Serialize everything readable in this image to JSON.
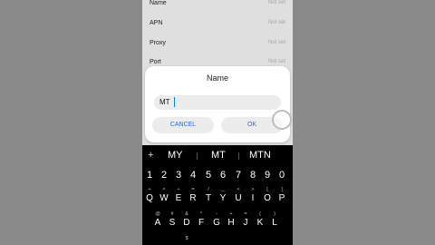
{
  "settings": {
    "rows": [
      {
        "label": "Name",
        "value": "Not set"
      },
      {
        "label": "APN",
        "value": "Not set"
      },
      {
        "label": "Proxy",
        "value": "Not set"
      },
      {
        "label": "Port",
        "value": "Not set"
      }
    ]
  },
  "dialog": {
    "title": "Name",
    "input_value": "MT",
    "cancel_label": "CANCEL",
    "ok_label": "OK"
  },
  "keyboard": {
    "plus_label": "+",
    "suggestions": [
      "MY",
      "MT",
      "MTN"
    ],
    "numbers": [
      "1",
      "2",
      "3",
      "4",
      "5",
      "6",
      "7",
      "8",
      "9",
      "0"
    ],
    "row1_symbols": [
      "+",
      "×",
      "÷",
      "=",
      "/",
      "_",
      "<",
      ">",
      "[",
      "]"
    ],
    "row1_letters": [
      "Q",
      "W",
      "E",
      "R",
      "T",
      "Y",
      "U",
      "I",
      "O",
      "P"
    ],
    "row2_symbols": [
      "@",
      "#",
      "&",
      "*",
      "-",
      "+",
      "=",
      "(",
      ")"
    ],
    "row2_letters": [
      "A",
      "S",
      "D",
      "F",
      "G",
      "H",
      "J",
      "K",
      "L"
    ],
    "row3_symbols": [
      "",
      "",
      "$",
      "",
      "",
      "",
      "",
      ""
    ]
  }
}
